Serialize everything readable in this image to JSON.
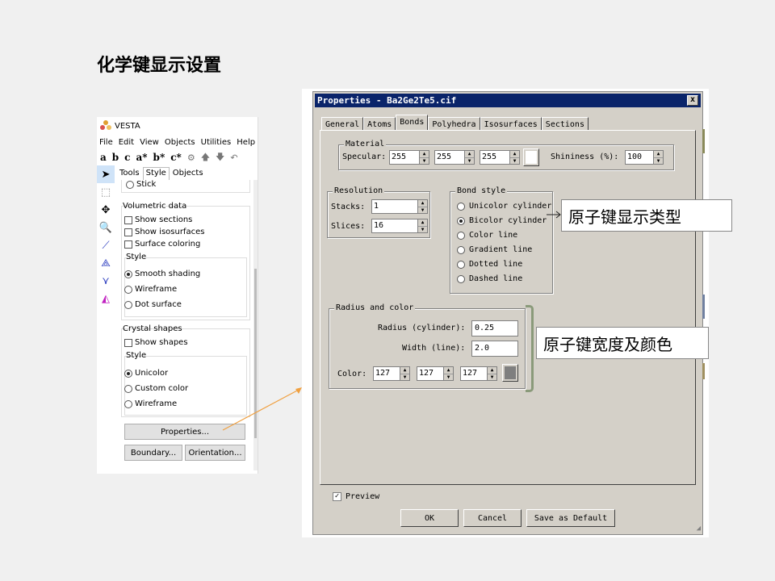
{
  "slide": {
    "title": "化学键显示设置"
  },
  "vesta": {
    "title": "VESTA",
    "menu": [
      "File",
      "Edit",
      "View",
      "Objects",
      "Utilities",
      "Help"
    ],
    "toolbar": [
      "a",
      "b",
      "c",
      "a*",
      "b*",
      "c*"
    ],
    "tabs": [
      "Tools",
      "Style",
      "Objects"
    ],
    "stick_label": "Stick",
    "volumetric": {
      "title": "Volumetric data",
      "checks": [
        "Show sections",
        "Show isosurfaces",
        "Surface coloring"
      ],
      "style_title": "Style",
      "radios": [
        "Smooth shading",
        "Wireframe",
        "Dot surface"
      ],
      "selected": 0
    },
    "crystal": {
      "title": "Crystal shapes",
      "check": "Show shapes",
      "style_title": "Style",
      "radios": [
        "Unicolor",
        "Custom color",
        "Wireframe"
      ],
      "selected": 0
    },
    "buttons": {
      "properties": "Properties...",
      "boundary": "Boundary...",
      "orientation": "Orientation..."
    }
  },
  "dialog": {
    "title": "Properties - Ba2Ge2Te5.cif",
    "close": "x",
    "tabs": [
      "General",
      "Atoms",
      "Bonds",
      "Polyhedra",
      "Isosurfaces",
      "Sections"
    ],
    "active_tab": "Bonds",
    "material": {
      "title": "Material",
      "specular_label": "Specular:",
      "specular": [
        "255",
        "255",
        "255"
      ],
      "specular_color": "#ffffff",
      "shininess_label": "Shininess (%):",
      "shininess": "100"
    },
    "resolution": {
      "title": "Resolution",
      "stacks_label": "Stacks:",
      "stacks": "1",
      "slices_label": "Slices:",
      "slices": "16"
    },
    "bond_style": {
      "title": "Bond style",
      "options": [
        "Unicolor cylinder",
        "Bicolor cylinder",
        "Color line",
        "Gradient line",
        "Dotted line",
        "Dashed line"
      ],
      "selected": 1
    },
    "radius_color": {
      "title": "Radius and color",
      "radius_label": "Radius (cylinder):",
      "radius": "0.25",
      "width_label": "Width (line):",
      "width": "2.0",
      "color_label": "Color:",
      "color": [
        "127",
        "127",
        "127"
      ],
      "swatch": "#7f7f7f"
    },
    "preview_label": "Preview",
    "preview_checked": true,
    "buttons": {
      "ok": "OK",
      "cancel": "Cancel",
      "save_default": "Save as Default"
    }
  },
  "callouts": {
    "bond_type": "原子键显示类型",
    "bond_width_color": "原子键宽度及颜色"
  },
  "colors": {
    "title_bar": "#0a246a",
    "dialog_bg": "#d4d0c8",
    "arrow": "#f0a040"
  }
}
